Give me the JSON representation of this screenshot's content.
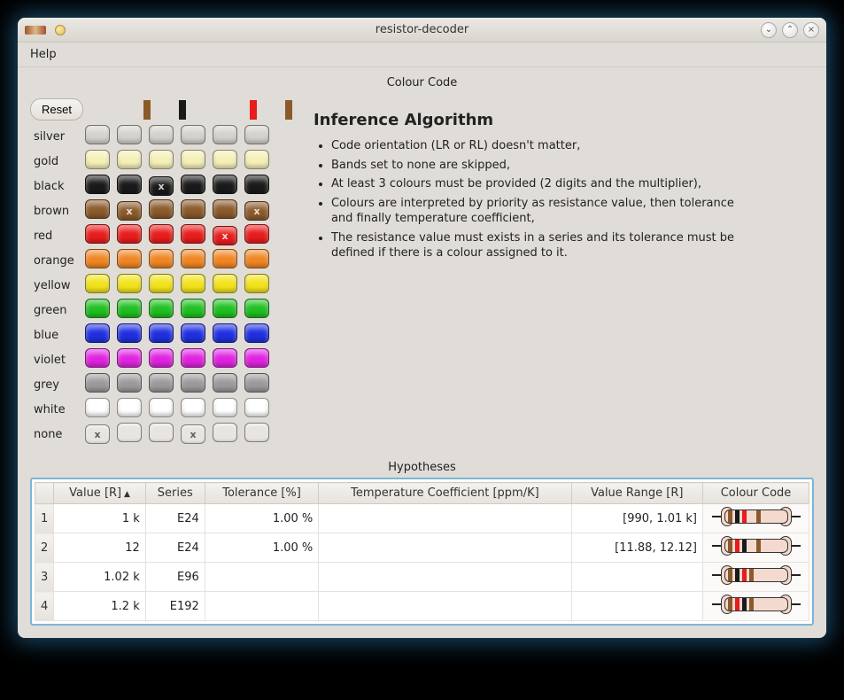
{
  "window": {
    "title": "resistor-decoder"
  },
  "menu": {
    "help": "Help"
  },
  "section_titles": {
    "colour_code": "Colour Code",
    "hypotheses": "Hypotheses"
  },
  "reset_label": "Reset",
  "info": {
    "heading": "Inference Algorithm",
    "bullets": [
      "Code orientation (LR or RL) doesn't matter,",
      "Bands set to none are skipped,",
      "At least 3 colours must be provided (2 digits and the multiplier),",
      "Colours are interpreted by priority as resistance value, then tolerance and finally temperature coefficient,",
      "The resistance value must exists in a series and its tolerance must be defined if there is a colour assigned to it."
    ]
  },
  "colour_rows": [
    {
      "name": "silver",
      "hex": "#d3d2cc"
    },
    {
      "name": "gold",
      "hex": "#f4f0b6"
    },
    {
      "name": "black",
      "hex": "#1a1a1a",
      "dark": true
    },
    {
      "name": "brown",
      "hex": "#8b5a2b",
      "dark": true
    },
    {
      "name": "red",
      "hex": "#e81c1c",
      "dark": true
    },
    {
      "name": "orange",
      "hex": "#f08522"
    },
    {
      "name": "yellow",
      "hex": "#f2e21a"
    },
    {
      "name": "green",
      "hex": "#1fbf1f",
      "dark": true
    },
    {
      "name": "blue",
      "hex": "#1f2fe0",
      "dark": true
    },
    {
      "name": "violet",
      "hex": "#e022e0",
      "dark": true
    },
    {
      "name": "grey",
      "hex": "#9a9a9a"
    },
    {
      "name": "white",
      "hex": "#ffffff"
    },
    {
      "name": "none",
      "hex": null
    }
  ],
  "band_count": 6,
  "selected_bands": [
    "none",
    "brown",
    "black",
    "none",
    "red",
    "brown"
  ],
  "band_preview_colors": [
    "",
    "#8b5a2b",
    "#1a1a1a",
    "",
    "#e81c1c",
    "#8b5a2b"
  ],
  "hypotheses": {
    "columns": [
      {
        "key": "value",
        "label": "Value [R]",
        "sorted": true
      },
      {
        "key": "series",
        "label": "Series"
      },
      {
        "key": "tolerance",
        "label": "Tolerance [%]"
      },
      {
        "key": "tempco",
        "label": "Temperature Coefficient [ppm/K]"
      },
      {
        "key": "range",
        "label": "Value Range [R]"
      },
      {
        "key": "code",
        "label": "Colour Code"
      }
    ],
    "rows": [
      {
        "value": "1 k",
        "series": "E24",
        "tolerance": "1.00 %",
        "tempco": "",
        "range": "[990, 1.01 k]",
        "bands": [
          "#8b5a2b",
          "#1a1a1a",
          "#e81c1c",
          "",
          "#8b5a2b"
        ]
      },
      {
        "value": "12",
        "series": "E24",
        "tolerance": "1.00 %",
        "tempco": "",
        "range": "[11.88, 12.12]",
        "bands": [
          "#8b5a2b",
          "#e81c1c",
          "#1a1a1a",
          "",
          "#8b5a2b"
        ]
      },
      {
        "value": "1.02 k",
        "series": "E96",
        "tolerance": "",
        "tempco": "",
        "range": "",
        "bands": [
          "#8b5a2b",
          "#1a1a1a",
          "#e81c1c",
          "#8b5a2b",
          ""
        ]
      },
      {
        "value": "1.2 k",
        "series": "E192",
        "tolerance": "",
        "tempco": "",
        "range": "",
        "bands": [
          "#8b5a2b",
          "#e81c1c",
          "#1a1a1a",
          "#8b5a2b",
          ""
        ]
      }
    ]
  }
}
